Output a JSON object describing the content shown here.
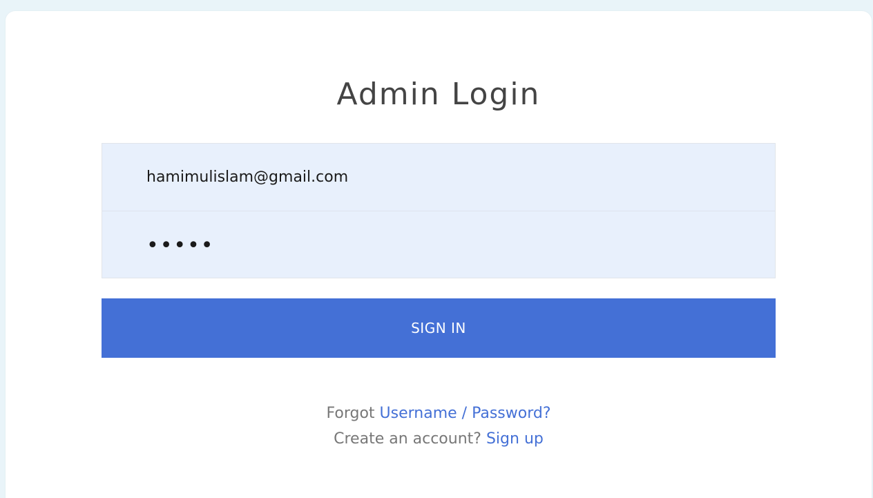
{
  "login": {
    "title": "Admin Login",
    "email_value": "hamimulislam@gmail.com",
    "password_value": "12345",
    "sign_in_label": "SIGN IN"
  },
  "footer": {
    "forgot_prefix": "Forgot",
    "forgot_link": "Username / Password?",
    "create_prefix": "Create an account?",
    "signup_link": "Sign up"
  },
  "colors": {
    "accent": "#4470d6",
    "input_bg": "#e8f0fc",
    "page_bg": "#e9f4f9"
  }
}
